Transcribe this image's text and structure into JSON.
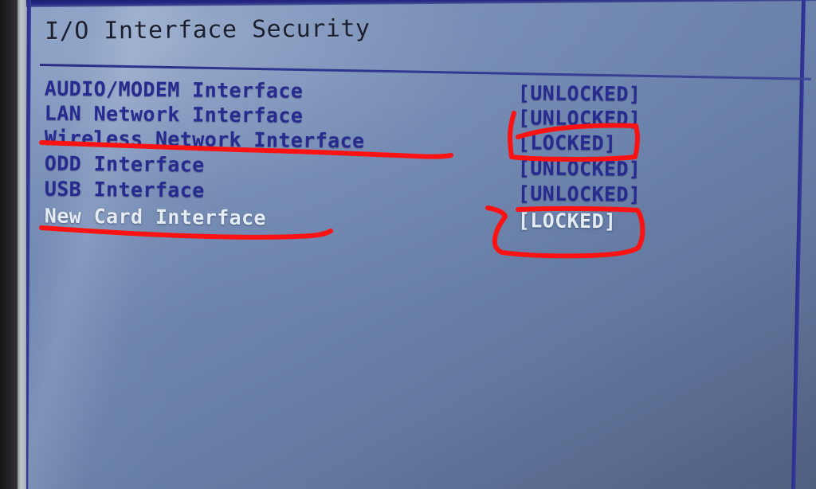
{
  "screen": {
    "title": "I/O Interface Security",
    "background_color": "#7089b5",
    "text_color_normal": "#272a8e",
    "text_color_selected": "#e6ecf4",
    "annotation_color": "#fb1212"
  },
  "menu": {
    "rows": [
      {
        "label": "AUDIO/MODEM Interface",
        "value": "[UNLOCKED]",
        "selected": false,
        "annotated": false
      },
      {
        "label": "LAN Network Interface",
        "value": "[UNLOCKED]",
        "selected": false,
        "annotated": false
      },
      {
        "label": "Wireless Network Interface",
        "value": "[LOCKED]",
        "selected": false,
        "annotated": true
      },
      {
        "label": "ODD Interface",
        "value": "[UNLOCKED]",
        "selected": false,
        "annotated": false
      },
      {
        "label": "USB Interface",
        "value": "[UNLOCKED]",
        "selected": false,
        "annotated": false
      },
      {
        "label": "New Card Interface",
        "value": "[LOCKED]",
        "selected": true,
        "annotated": true
      }
    ]
  },
  "annotations": {
    "underline_wireless": "red underline under Wireless Network Interface",
    "box_wireless_locked": "red box around [LOCKED]",
    "underline_new_card": "red underline under New Card Interface",
    "box_new_card_locked": "red oval around [LOCKED]"
  }
}
